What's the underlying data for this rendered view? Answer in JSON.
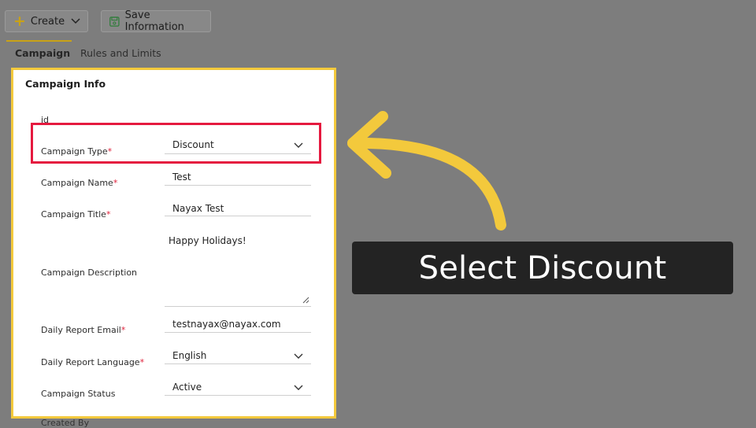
{
  "toolbar": {
    "create_label": "Create",
    "save_label": "Save Information",
    "plus_glyph": "+",
    "icons": [
      "plus-icon",
      "chevron-down-icon",
      "save-disk-icon"
    ]
  },
  "tabs": [
    {
      "label": "Campaign",
      "active": true
    },
    {
      "label": "Rules and Limits",
      "active": false
    }
  ],
  "panel": {
    "title": "Campaign Info",
    "fields": {
      "id": {
        "label": "id"
      },
      "campaign_type": {
        "label": "Campaign Type",
        "value": "Discount",
        "required_mark": "*"
      },
      "campaign_name": {
        "label": "Campaign Name",
        "value": "Test",
        "required_mark": "*"
      },
      "campaign_title": {
        "label": "Campaign Title",
        "value": "Nayax Test",
        "required_mark": "*"
      },
      "campaign_description": {
        "label": "Campaign Description",
        "value": "Happy Holidays!"
      },
      "daily_report_email": {
        "label": "Daily Report Email",
        "value": "testnayax@nayax.com",
        "required_mark": "*"
      },
      "daily_report_language": {
        "label": "Daily Report Language",
        "value": "English",
        "required_mark": "*"
      },
      "campaign_status": {
        "label": "Campaign Status",
        "value": "Active"
      }
    }
  },
  "below_panel_label": "Created By",
  "callout": {
    "text": "Select Discount"
  },
  "colors": {
    "accent_yellow": "#f3c93c",
    "highlight_red": "#e5193f",
    "required_red": "#e0213b",
    "callout_bg": "#232323",
    "overlay_gray": "#7d7d7d"
  }
}
